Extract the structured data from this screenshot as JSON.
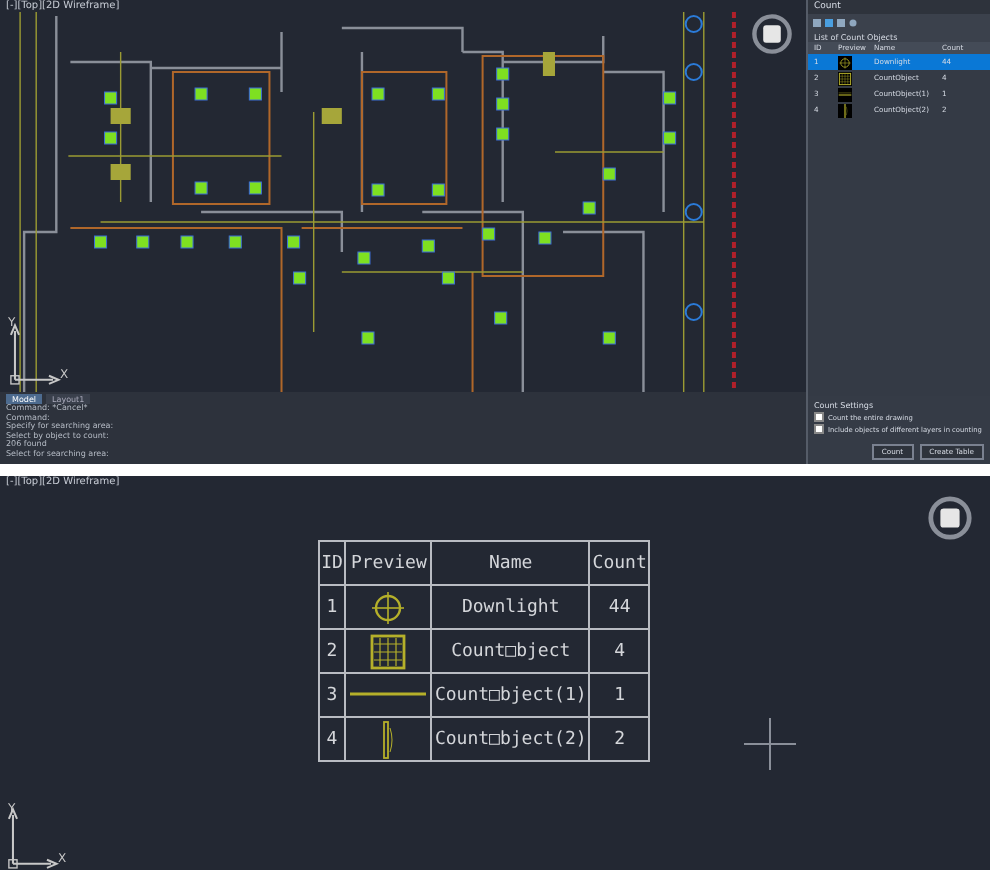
{
  "top_view": {
    "viewport_label": "[-][Top][2D Wireframe]",
    "axis_labels": [
      "Y",
      "X"
    ],
    "command_tabs": [
      "Model",
      "Layout1"
    ],
    "command_lines": [
      "Command: *Cancel*",
      "Command:",
      "Specify for searching area:",
      "Select by object to count:",
      "206 found",
      "Select for searching area:"
    ],
    "count_panel": {
      "title": "Count",
      "list_title": "List of Count Objects",
      "columns": [
        "ID",
        "Preview",
        "Name",
        "Count"
      ],
      "rows": [
        {
          "id": "1",
          "kind": "circle",
          "name": "Downlight",
          "count": "44",
          "selected": true
        },
        {
          "id": "2",
          "kind": "grid",
          "name": "CountObject",
          "count": "4",
          "selected": false
        },
        {
          "id": "3",
          "kind": "hline",
          "name": "CountObject(1)",
          "count": "1",
          "selected": false
        },
        {
          "id": "4",
          "kind": "vline",
          "name": "CountObject(2)",
          "count": "2",
          "selected": false
        }
      ],
      "settings_title": "Count Settings",
      "settings": [
        {
          "label": "Count the entire drawing",
          "checked": false
        },
        {
          "label": "Include objects of different layers in counting",
          "checked": false
        }
      ],
      "buttons": [
        "Count",
        "Create Table"
      ]
    }
  },
  "bottom_view": {
    "viewport_label": "[-][Top][2D Wireframe]",
    "axis_labels": [
      "Y",
      "X"
    ],
    "table": {
      "columns": [
        "ID",
        "Preview",
        "Name",
        "Count"
      ],
      "rows": [
        {
          "id": "1",
          "kind": "circle",
          "name": "Downlight",
          "count": "44"
        },
        {
          "id": "2",
          "kind": "grid",
          "name": "Count□bject",
          "count": "4"
        },
        {
          "id": "3",
          "kind": "hline",
          "name": "Count□bject(1)",
          "count": "1"
        },
        {
          "id": "4",
          "kind": "vline",
          "name": "Count□bject(2)",
          "count": "2"
        }
      ]
    }
  }
}
